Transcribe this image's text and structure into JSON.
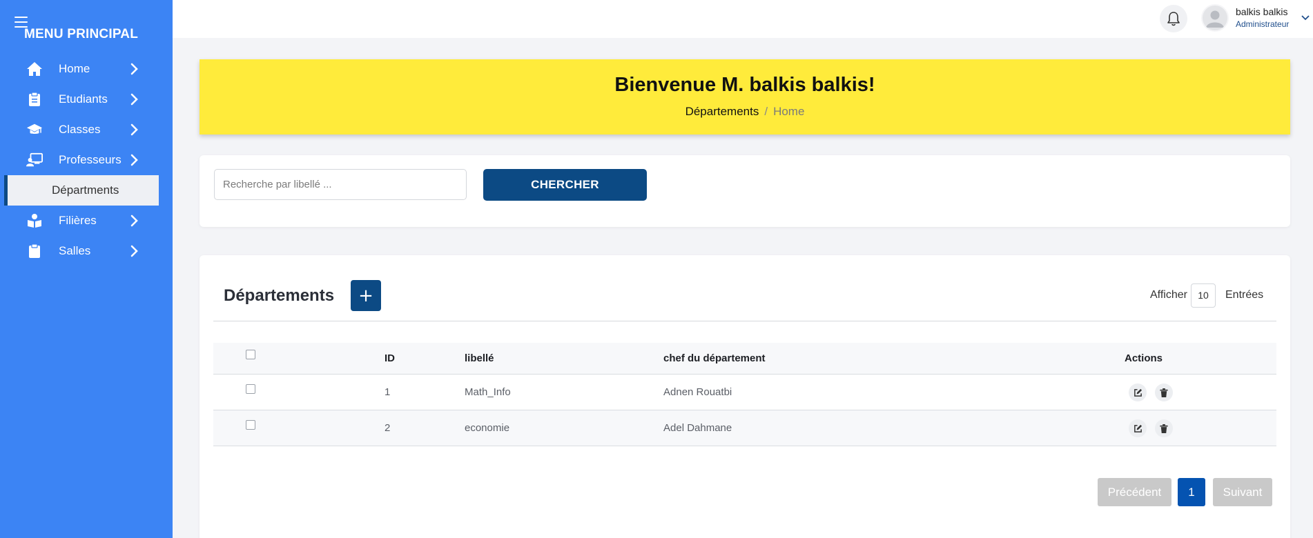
{
  "sidebar": {
    "title": "MENU PRINCIPAL",
    "items": [
      {
        "label": "Home",
        "icon": "home-icon"
      },
      {
        "label": "Etudiants",
        "icon": "clipboard-icon"
      },
      {
        "label": "Classes",
        "icon": "graduation-cap-icon"
      },
      {
        "label": "Professeurs",
        "icon": "teacher-icon"
      },
      {
        "label": "Filières",
        "icon": "reader-icon"
      },
      {
        "label": "Salles",
        "icon": "clipboard-icon"
      }
    ],
    "active_sub": {
      "label": "Départments"
    }
  },
  "topbar": {
    "user_name": "balkis balkis",
    "user_role": "Administrateur"
  },
  "banner": {
    "title": "Bienvenue M. balkis balkis!",
    "crumb_current": "Départements",
    "crumb_separator": "/",
    "crumb_home": "Home"
  },
  "search": {
    "placeholder": "Recherche par libellé ...",
    "value": "",
    "button_label": "CHERCHER"
  },
  "table_section": {
    "title": "Départements",
    "add_label": "+",
    "show_label": "Afficher",
    "page_size": "10",
    "entries_label": "Entrées",
    "columns": {
      "id": "ID",
      "libelle": "libellé",
      "chef": "chef du département",
      "actions": "Actions"
    },
    "rows": [
      {
        "id": "1",
        "libelle": "Math_Info",
        "chef": "Adnen Rouatbi"
      },
      {
        "id": "2",
        "libelle": "economie",
        "chef": "Adel Dahmane"
      }
    ]
  },
  "pagination": {
    "prev": "Précédent",
    "current": "1",
    "next": "Suivant"
  },
  "colors": {
    "sidebar": "#3c84f4",
    "primary": "#0c4a84",
    "banner": "#ffeb3b",
    "page_active": "#0553b1"
  }
}
